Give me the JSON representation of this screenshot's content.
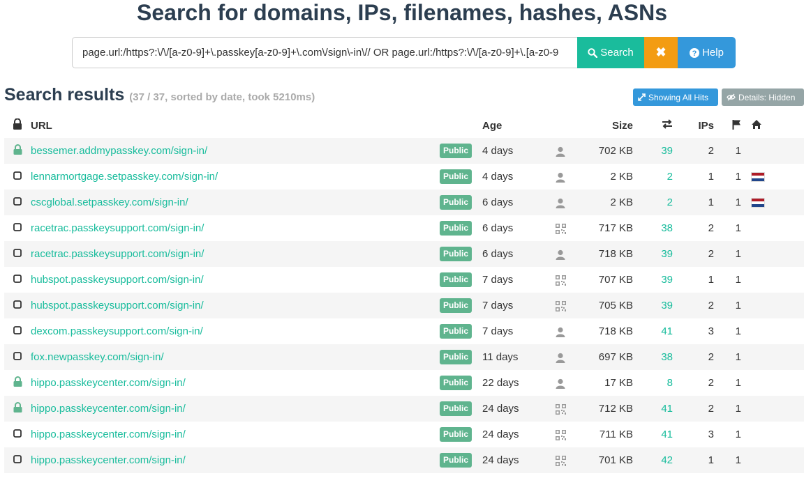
{
  "header": {
    "title": "Search for domains, IPs, filenames, hashes, ASNs"
  },
  "search": {
    "query": "page.url:/https?:\\/\\/[a-z0-9]+\\.passkey[a-z0-9]+\\.com\\/sign\\-in\\// OR page.url:/https?:\\/\\/[a-z0-9]+\\.[a-z0-9",
    "search_label": "Search",
    "clear_label": "✖",
    "help_label": "Help"
  },
  "results": {
    "title": "Search results",
    "meta": "(37 / 37, sorted by date, took 5210ms)",
    "showing_all_hits_label": "Showing All Hits",
    "details_label": "Details: Hidden",
    "columns": {
      "url": "URL",
      "age": "Age",
      "size": "Size",
      "ips": "IPs"
    },
    "rows": [
      {
        "secure": true,
        "url": "bessemer.addmypasskey.com/sign-in/",
        "visibility": "Public",
        "age": "4 days",
        "type": "user-icon",
        "size": "702 KB",
        "requests": "39",
        "ips": "2",
        "count": "1",
        "country": ""
      },
      {
        "secure": false,
        "url": "lennarmortgage.setpasskey.com/sign-in/",
        "visibility": "Public",
        "age": "4 days",
        "type": "user-icon",
        "size": "2 KB",
        "requests": "2",
        "ips": "1",
        "count": "1",
        "country": "nl-flag-icon"
      },
      {
        "secure": false,
        "url": "cscglobal.setpasskey.com/sign-in/",
        "visibility": "Public",
        "age": "6 days",
        "type": "user-icon",
        "size": "2 KB",
        "requests": "2",
        "ips": "1",
        "count": "1",
        "country": "nl-flag-icon"
      },
      {
        "secure": false,
        "url": "racetrac.passkeysupport.com/sign-in/",
        "visibility": "Public",
        "age": "6 days",
        "type": "qrcode-icon",
        "size": "717 KB",
        "requests": "38",
        "ips": "2",
        "count": "1",
        "country": ""
      },
      {
        "secure": false,
        "url": "racetrac.passkeysupport.com/sign-in/",
        "visibility": "Public",
        "age": "6 days",
        "type": "user-icon",
        "size": "718 KB",
        "requests": "39",
        "ips": "2",
        "count": "1",
        "country": ""
      },
      {
        "secure": false,
        "url": "hubspot.passkeysupport.com/sign-in/",
        "visibility": "Public",
        "age": "7 days",
        "type": "qrcode-icon",
        "size": "707 KB",
        "requests": "39",
        "ips": "1",
        "count": "1",
        "country": ""
      },
      {
        "secure": false,
        "url": "hubspot.passkeysupport.com/sign-in/",
        "visibility": "Public",
        "age": "7 days",
        "type": "qrcode-icon",
        "size": "705 KB",
        "requests": "39",
        "ips": "2",
        "count": "1",
        "country": ""
      },
      {
        "secure": false,
        "url": "dexcom.passkeysupport.com/sign-in/",
        "visibility": "Public",
        "age": "7 days",
        "type": "user-icon",
        "size": "718 KB",
        "requests": "41",
        "ips": "3",
        "count": "1",
        "country": ""
      },
      {
        "secure": false,
        "url": "fox.newpasskey.com/sign-in/",
        "visibility": "Public",
        "age": "11 days",
        "type": "user-icon",
        "size": "697 KB",
        "requests": "38",
        "ips": "2",
        "count": "1",
        "country": ""
      },
      {
        "secure": true,
        "url": "hippo.passkeycenter.com/sign-in/",
        "visibility": "Public",
        "age": "22 days",
        "type": "user-icon",
        "size": "17 KB",
        "requests": "8",
        "ips": "2",
        "count": "1",
        "country": ""
      },
      {
        "secure": true,
        "url": "hippo.passkeycenter.com/sign-in/",
        "visibility": "Public",
        "age": "24 days",
        "type": "qrcode-icon",
        "size": "712 KB",
        "requests": "41",
        "ips": "2",
        "count": "1",
        "country": ""
      },
      {
        "secure": false,
        "url": "hippo.passkeycenter.com/sign-in/",
        "visibility": "Public",
        "age": "24 days",
        "type": "qrcode-icon",
        "size": "711 KB",
        "requests": "41",
        "ips": "3",
        "count": "1",
        "country": ""
      },
      {
        "secure": false,
        "url": "hippo.passkeycenter.com/sign-in/",
        "visibility": "Public",
        "age": "24 days",
        "type": "qrcode-icon",
        "size": "701 KB",
        "requests": "42",
        "ips": "1",
        "count": "1",
        "country": ""
      }
    ]
  },
  "colors": {
    "accent": "#1abc9c",
    "warning": "#f39c12",
    "info": "#3498db",
    "muted": "#95a5a6",
    "badge": "#5fb48e"
  }
}
